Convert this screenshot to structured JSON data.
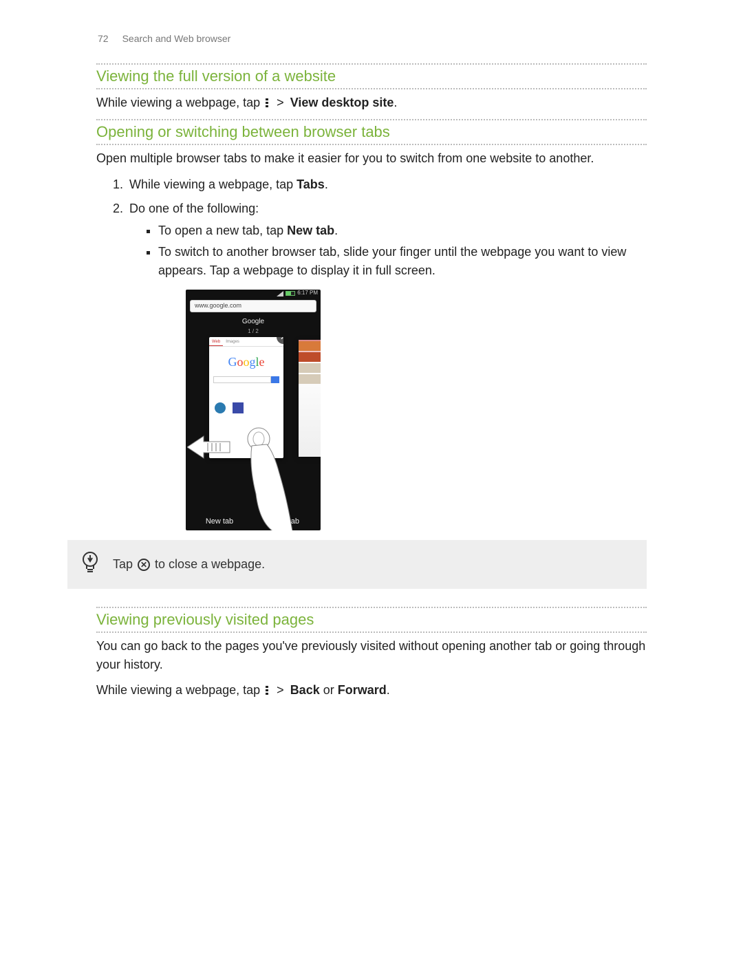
{
  "header": {
    "page_number": "72",
    "chapter": "Search and Web browser"
  },
  "section1": {
    "heading": "Viewing the full version of a website",
    "body_before_icon": "While viewing a webpage, tap",
    "separator": " > ",
    "body_bold": "View desktop site",
    "body_period": "."
  },
  "section2": {
    "heading": "Opening or switching between browser tabs",
    "intro": "Open multiple browser tabs to make it easier for you to switch from one website to another.",
    "step1_before": "While viewing a webpage, tap ",
    "step1_bold": "Tabs",
    "step1_after": ".",
    "step2": "Do one of the following:",
    "bullet_a_before": "To open a new tab, tap ",
    "bullet_a_bold": "New tab",
    "bullet_a_after": ".",
    "bullet_b": "To switch to another browser tab, slide your finger until the webpage you want to view appears. Tap a webpage to display it in full screen."
  },
  "phone": {
    "time": "6:17 PM",
    "url": "www.google.com",
    "title": "Google",
    "subtitle": "1 / 2",
    "tab_web": "Web",
    "tab_images": "Images",
    "btn_newtab": "New tab",
    "btn_incognito": "nito tab"
  },
  "tip": {
    "before_icon": "Tap ",
    "after_icon": " to close a webpage."
  },
  "section3": {
    "heading": "Viewing previously visited pages",
    "intro": "You can go back to the pages you've previously visited without opening another tab or going through your history.",
    "body_before_icon": "While viewing a webpage, tap",
    "separator": " > ",
    "bold_back": "Back",
    "or": " or ",
    "bold_forward": "Forward",
    "period": "."
  }
}
